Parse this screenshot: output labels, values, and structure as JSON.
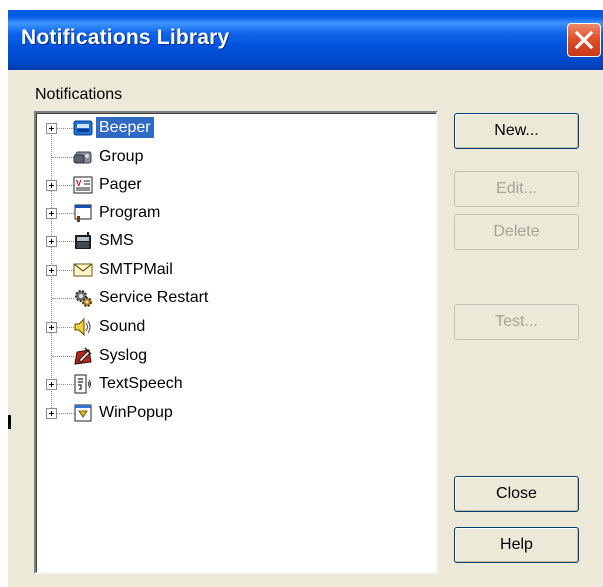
{
  "window": {
    "title": "Notifications Library"
  },
  "tree": {
    "label": "Notifications",
    "items": [
      {
        "label": "Beeper",
        "icon": "beeper-icon",
        "expandable": true,
        "selected": true
      },
      {
        "label": "Group",
        "icon": "group-icon",
        "expandable": false,
        "selected": false
      },
      {
        "label": "Pager",
        "icon": "pager-icon",
        "expandable": true,
        "selected": false
      },
      {
        "label": "Program",
        "icon": "program-icon",
        "expandable": true,
        "selected": false
      },
      {
        "label": "SMS",
        "icon": "sms-icon",
        "expandable": true,
        "selected": false
      },
      {
        "label": "SMTPMail",
        "icon": "envelope-icon",
        "expandable": true,
        "selected": false
      },
      {
        "label": "Service Restart",
        "icon": "service-restart-icon",
        "expandable": false,
        "selected": false
      },
      {
        "label": "Sound",
        "icon": "speaker-icon",
        "expandable": true,
        "selected": false
      },
      {
        "label": "Syslog",
        "icon": "syslog-icon",
        "expandable": false,
        "selected": false
      },
      {
        "label": "TextSpeech",
        "icon": "text-speech-icon",
        "expandable": true,
        "selected": false
      },
      {
        "label": "WinPopup",
        "icon": "winpopup-icon",
        "expandable": true,
        "selected": false
      }
    ]
  },
  "buttons": {
    "new": {
      "label": "New...",
      "enabled": true
    },
    "edit": {
      "label": "Edit...",
      "enabled": false
    },
    "delete": {
      "label": "Delete",
      "enabled": false
    },
    "test": {
      "label": "Test...",
      "enabled": false
    },
    "close": {
      "label": "Close",
      "enabled": true
    },
    "help": {
      "label": "Help",
      "enabled": true
    }
  },
  "colors": {
    "titlebar": "#0055e5",
    "selection": "#316ac5",
    "dialog_bg": "#ece9d8",
    "close_button": "#e0502a"
  }
}
